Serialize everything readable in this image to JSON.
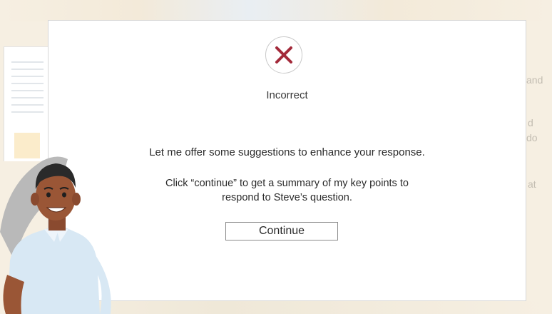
{
  "background": {
    "right_text": [
      "and",
      "d",
      "do",
      "at"
    ]
  },
  "modal": {
    "icon": "close-x-icon",
    "status": "Incorrect",
    "headline": "Let me offer some suggestions to enhance your response.",
    "instruction_line1": "Click “continue” to get a summary of my key points to",
    "instruction_line2": "respond to Steve’s question.",
    "continue_label": "Continue",
    "accent_color": "#a32a3a"
  }
}
